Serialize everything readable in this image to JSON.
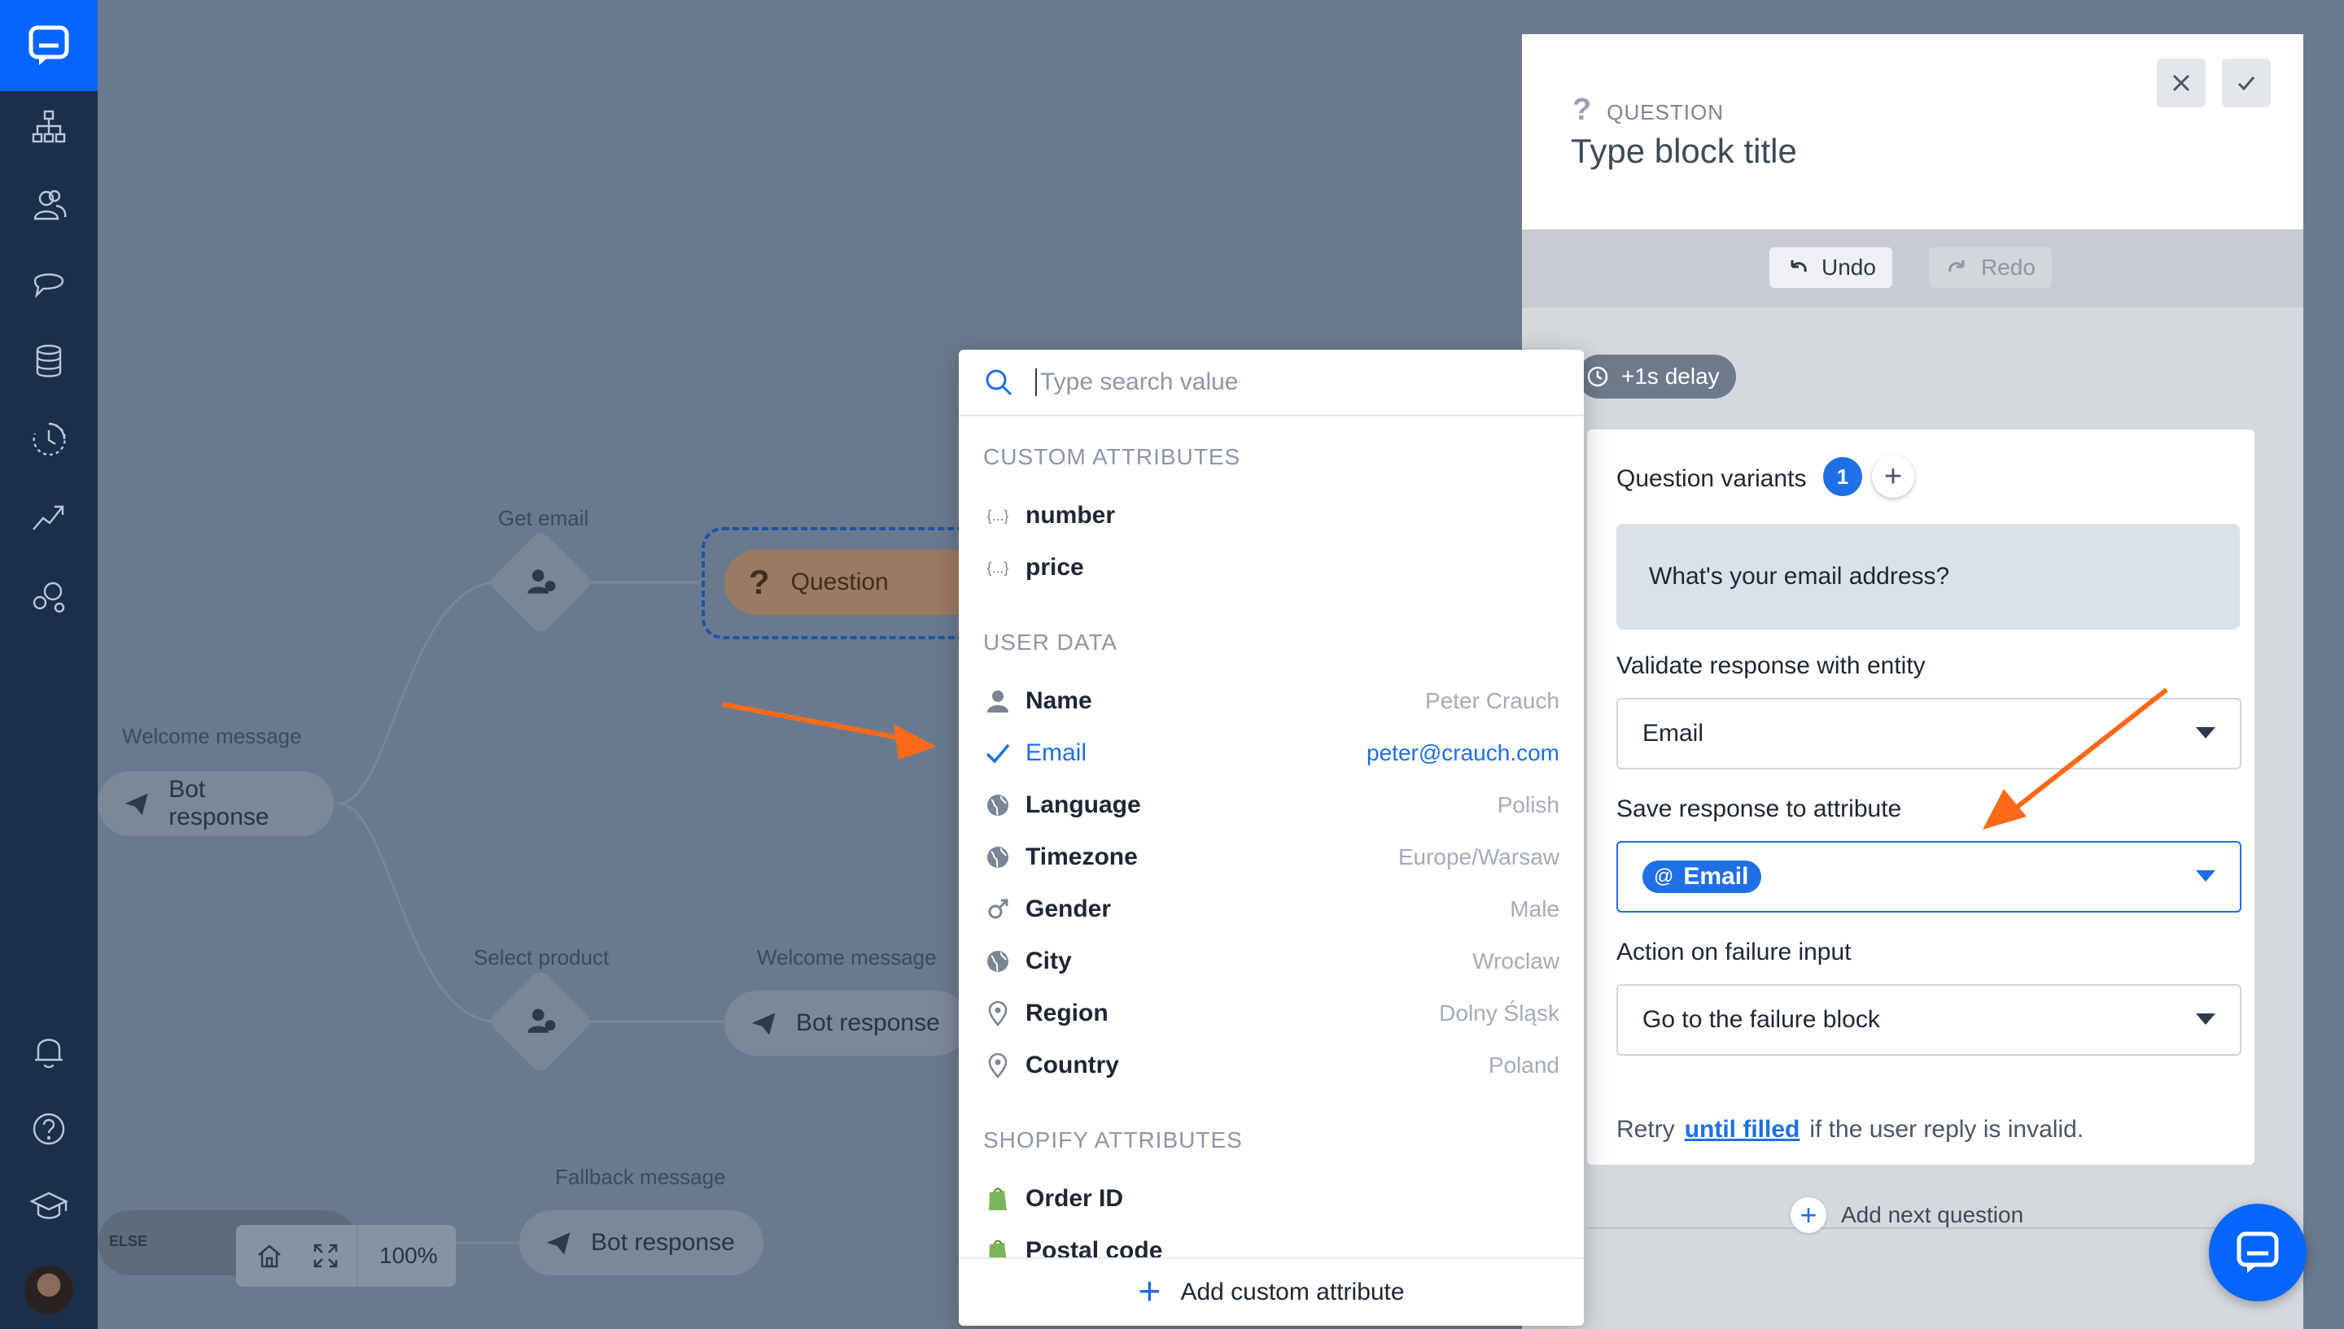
{
  "sidebar": {
    "items": [
      "chatbots-icon",
      "users-icon",
      "conversations-icon",
      "database-icon",
      "history-icon",
      "reports-icon",
      "integrations-icon",
      "notifications-icon",
      "help-icon",
      "academy-icon"
    ]
  },
  "canvas": {
    "nodes": {
      "get_email_label": "Get email",
      "question_label": "Question",
      "welcome_label_1": "Welcome message",
      "bot_response_1": "Bot response",
      "select_product_label": "Select product",
      "welcome_label_2": "Welcome message",
      "bot_response_2": "Bot response",
      "fallback_label": "Fallback message",
      "bot_response_3": "Bot response",
      "else_label": "ELSE"
    },
    "zoom": "100%"
  },
  "dropdown": {
    "search_placeholder": "Type search value",
    "sections": {
      "custom": "CUSTOM ATTRIBUTES",
      "user": "USER DATA",
      "shopify": "SHOPIFY ATTRIBUTES"
    },
    "custom_items": [
      {
        "label": "number"
      },
      {
        "label": "price"
      }
    ],
    "user_items": [
      {
        "label": "Name",
        "value": "Peter Crauch",
        "icon": "person-icon"
      },
      {
        "label": "Email",
        "value": "peter@crauch.com",
        "icon": "check-icon",
        "selected": true
      },
      {
        "label": "Language",
        "value": "Polish",
        "icon": "globe-icon"
      },
      {
        "label": "Timezone",
        "value": "Europe/Warsaw",
        "icon": "globe-icon"
      },
      {
        "label": "Gender",
        "value": "Male",
        "icon": "gender-icon"
      },
      {
        "label": "City",
        "value": "Wroclaw",
        "icon": "globe-icon"
      },
      {
        "label": "Region",
        "value": "Dolny Śląsk",
        "icon": "pin-icon"
      },
      {
        "label": "Country",
        "value": "Poland",
        "icon": "pin-icon"
      }
    ],
    "shopify_items": [
      {
        "label": "Order ID"
      },
      {
        "label": "Postal code"
      }
    ],
    "footer": "Add custom attribute"
  },
  "panel": {
    "type": "QUESTION",
    "title": "Type block title",
    "undo": "Undo",
    "redo": "Redo",
    "delay": "+1s delay",
    "question_variants": "Question variants",
    "variant_count": "1",
    "variant_text": "What's your email address?",
    "validate_label": "Validate response with entity",
    "validate_value": "Email",
    "save_label": "Save response to attribute",
    "save_value": "Email",
    "failure_label": "Action on failure input",
    "failure_value": "Go to the failure block",
    "retry_prefix": "Retry",
    "retry_link": "until filled",
    "retry_suffix": "if the user reply is invalid.",
    "add_next": "Add next question"
  },
  "colors": {
    "brand": "#0566ff",
    "sidebar": "#1b2f4a",
    "accent": "#1f6fe5",
    "arrow": "#ff6a1a"
  }
}
